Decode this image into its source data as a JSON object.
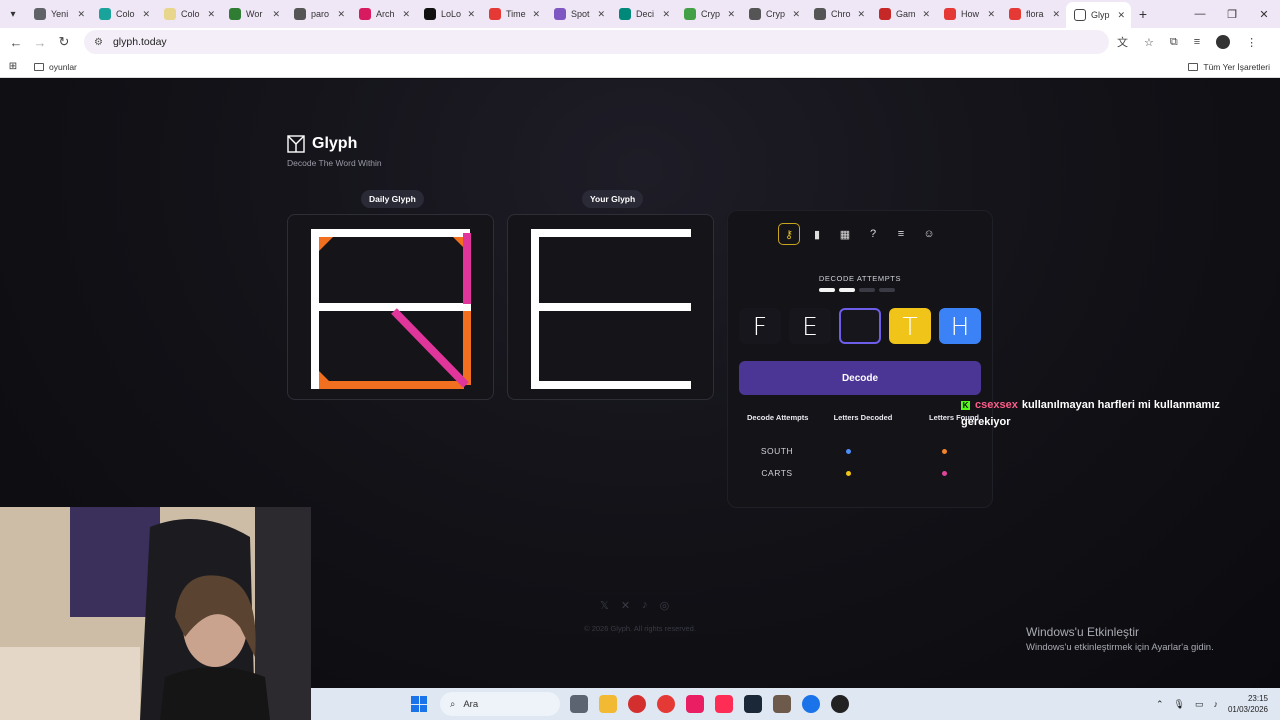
{
  "browser": {
    "tabs": [
      {
        "label": "Yeni",
        "color": "#5f6368"
      },
      {
        "label": "Colo",
        "color": "#1aa39a"
      },
      {
        "label": "Colo",
        "color": "#e9d68d"
      },
      {
        "label": "Wor",
        "color": "#2e7d32"
      },
      {
        "label": "paro",
        "color": "#555555"
      },
      {
        "label": "Arch",
        "color": "#d81b60"
      },
      {
        "label": "LoLo",
        "color": "#111111"
      },
      {
        "label": "Time",
        "color": "#e53935"
      },
      {
        "label": "Spot",
        "color": "#7e57c2"
      },
      {
        "label": "Deci",
        "color": "#00897b"
      },
      {
        "label": "Cryp",
        "color": "#43a047"
      },
      {
        "label": "Cryp",
        "color": "#555555"
      },
      {
        "label": "Chro",
        "color": "#555555"
      },
      {
        "label": "Gam",
        "color": "#c62828"
      },
      {
        "label": "How",
        "color": "#e53935"
      },
      {
        "label": "flora",
        "color": "#e53935"
      }
    ],
    "active_tab": {
      "label": "Glyp"
    },
    "url": "glyph.today",
    "bookmark_folder": "oyunlar",
    "all_bookmarks": "Tüm Yer İşaretleri"
  },
  "page": {
    "brand_title": "Glyph",
    "brand_tagline": "Decode The Word Within",
    "daily_label": "Daily Glyph",
    "yours_label": "Your Glyph",
    "attempts_label": "DECODE ATTEMPTS",
    "attempts_used": 2,
    "attempts_total": 4,
    "letter_tiles": [
      {
        "letter": "F",
        "style": "plain"
      },
      {
        "letter": "E",
        "style": "plain"
      },
      {
        "letter": "",
        "style": "empty"
      },
      {
        "letter": "T",
        "style": "yellow"
      },
      {
        "letter": "H",
        "style": "blue"
      }
    ],
    "decode_button": "Decode",
    "stats_headers": [
      "Decode Attempts",
      "Letters Decoded",
      "Letters Found"
    ],
    "stats_rows": [
      {
        "word": "SOUTH",
        "decoded_color": "#4f8ef7",
        "found_color": "#f2852a"
      },
      {
        "word": "CARTS",
        "decoded_color": "#f0c419",
        "found_color": "#e0459a"
      }
    ],
    "footer_copyright": "© 2026 Glyph. All rights reserved.",
    "colors": {
      "accent": "#4b3595",
      "orange": "#f26f1f",
      "magenta": "#e0359a",
      "yellow": "#f0c419",
      "blue": "#3b82f6"
    }
  },
  "overlay": {
    "chat_user": "csexsex",
    "chat_message": "kullanılmayan harfleri mi kullanmamız gerekiyor",
    "activate_title": "Windows'u Etkinleştir",
    "activate_subtitle": "Windows'u etkinleştirmek için Ayarlar'a gidin."
  },
  "taskbar": {
    "search_placeholder": "Ara",
    "time": "23:15",
    "date": "01/03/2026"
  }
}
